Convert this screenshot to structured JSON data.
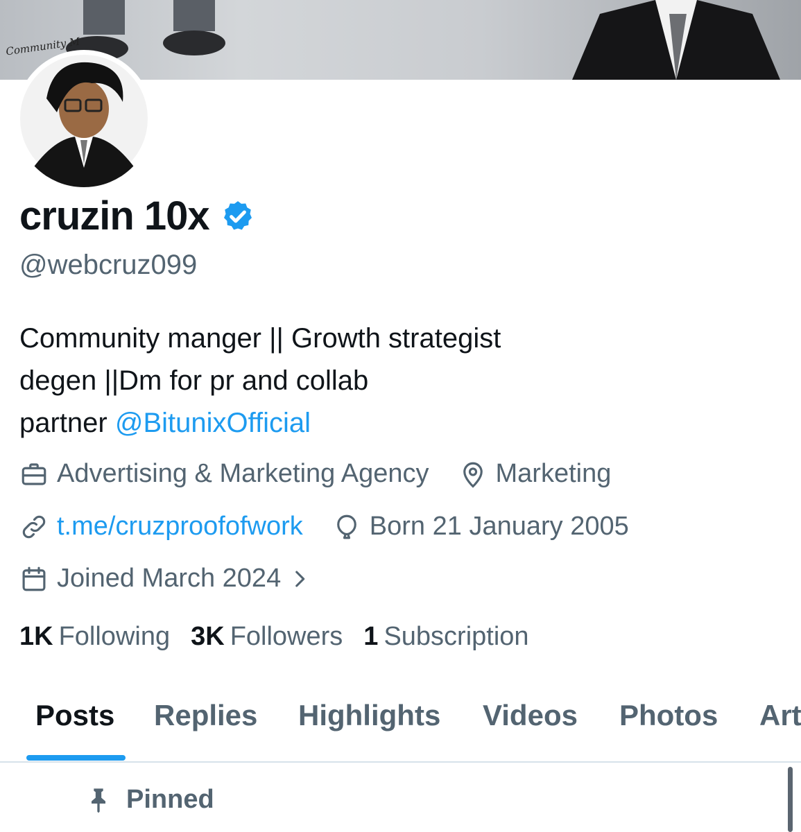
{
  "banner": {
    "signature_text": "Community M"
  },
  "profile": {
    "display_name": "cruzin 10x",
    "handle": "@webcruz099",
    "verified": true,
    "bio": {
      "line1": "Community manger || Growth strategist",
      "line2": "degen ||Dm for pr and collab",
      "line3_prefix": "partner ",
      "line3_mention": "@BitunixOfficial"
    },
    "category": "Advertising & Marketing Agency",
    "location": "Marketing",
    "website": "t.me/cruzproofofwork",
    "birthday": "Born 21 January 2005",
    "joined": "Joined March 2024"
  },
  "stats": {
    "following_count": "1K",
    "following_label": "Following",
    "followers_count": "3K",
    "followers_label": "Followers",
    "subscription_count": "1",
    "subscription_label": "Subscription"
  },
  "tabs": [
    {
      "label": "Posts",
      "active": true
    },
    {
      "label": "Replies",
      "active": false
    },
    {
      "label": "Highlights",
      "active": false
    },
    {
      "label": "Videos",
      "active": false
    },
    {
      "label": "Photos",
      "active": false
    },
    {
      "label": "Art",
      "active": false
    }
  ],
  "pinned_label": "Pinned",
  "colors": {
    "accent": "#1d9bf0",
    "text": "#0f1419",
    "muted": "#536471"
  },
  "icons": [
    "briefcase-icon",
    "location-pin-icon",
    "link-icon",
    "balloon-icon",
    "calendar-icon",
    "chevron-right-icon",
    "verified-badge-icon",
    "pin-icon"
  ]
}
